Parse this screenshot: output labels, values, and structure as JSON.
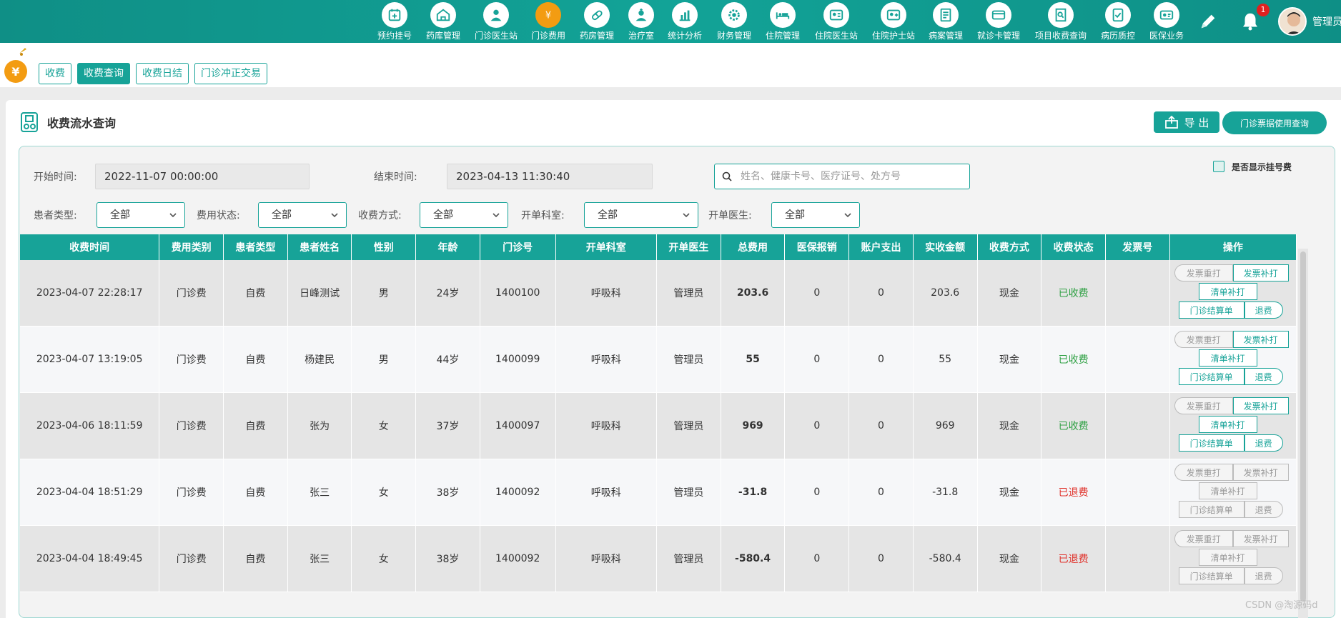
{
  "topnav": [
    {
      "label": "预约挂号",
      "icon": "calendar-plus-icon"
    },
    {
      "label": "药库管理",
      "icon": "warehouse-icon"
    },
    {
      "label": "门诊医生站",
      "icon": "doctor-icon"
    },
    {
      "label": "门诊费用",
      "icon": "yen-coin-icon",
      "active": true
    },
    {
      "label": "药房管理",
      "icon": "pill-icon"
    },
    {
      "label": "治疗室",
      "icon": "nurse-icon"
    },
    {
      "label": "统计分析",
      "icon": "bar-chart-icon"
    },
    {
      "label": "财务管理",
      "icon": "gear-coin-icon"
    },
    {
      "label": "住院管理",
      "icon": "hospital-bed-icon"
    },
    {
      "label": "住院医生站",
      "icon": "doctor-card-icon"
    },
    {
      "label": "住院护士站",
      "icon": "nurse-card-icon"
    },
    {
      "label": "病案管理",
      "icon": "folder-icon"
    },
    {
      "label": "就诊卡管理",
      "icon": "card-icon"
    },
    {
      "label": "项目收费查询",
      "icon": "search-document-icon"
    },
    {
      "label": "病历质控",
      "icon": "record-check-icon"
    },
    {
      "label": "医保业务",
      "icon": "insurance-card-icon"
    }
  ],
  "user": {
    "name": "管理员",
    "notification_count": "1"
  },
  "subnav": {
    "tabs": [
      "收费",
      "收费查询",
      "收费日结",
      "门诊冲正交易"
    ],
    "active_index": 1
  },
  "panel": {
    "title": "收费流水查询",
    "export_label": "导 出",
    "ticket_label": "门诊票据使用查询"
  },
  "filters": {
    "start_label": "开始时间:",
    "start_value": "2022-11-07 00:00:00",
    "end_label": "结束时间:",
    "end_value": "2023-04-13 11:30:40",
    "search_placeholder": "姓名、健康卡号、医疗证号、处方号",
    "show_reg_fee_label": "是否显示挂号费",
    "patient_type_label": "患者类型:",
    "patient_type_value": "全部",
    "fee_status_label": "费用状态:",
    "fee_status_value": "全部",
    "pay_method_label": "收费方式:",
    "pay_method_value": "全部",
    "dept_label": "开单科室:",
    "dept_value": "全部",
    "doctor_label": "开单医生:",
    "doctor_value": "全部"
  },
  "table": {
    "columns": [
      "收费时间",
      "费用类别",
      "患者类型",
      "患者姓名",
      "性别",
      "年龄",
      "门诊号",
      "开单科室",
      "开单医生",
      "总费用",
      "医保报销",
      "账户支出",
      "实收金额",
      "收费方式",
      "收费状态",
      "发票号",
      "操作"
    ],
    "ops": [
      "发票重打",
      "发票补打",
      "清单补打",
      "门诊结算单",
      "退费"
    ],
    "rows": [
      {
        "time": "2023-04-07 22:28:17",
        "cat": "门诊费",
        "ptype": "自费",
        "name": "日峰测试",
        "sex": "男",
        "age": "24岁",
        "no": "1400100",
        "dept": "呼吸科",
        "doctor": "管理员",
        "total": "203.6",
        "insure": "0",
        "account": "0",
        "actual": "203.6",
        "method": "现金",
        "status": "已收费",
        "invoice": ""
      },
      {
        "time": "2023-04-07 13:19:05",
        "cat": "门诊费",
        "ptype": "自费",
        "name": "杨建民",
        "sex": "男",
        "age": "44岁",
        "no": "1400099",
        "dept": "呼吸科",
        "doctor": "管理员",
        "total": "55",
        "insure": "0",
        "account": "0",
        "actual": "55",
        "method": "现金",
        "status": "已收费",
        "invoice": ""
      },
      {
        "time": "2023-04-06 18:11:59",
        "cat": "门诊费",
        "ptype": "自费",
        "name": "张为",
        "sex": "女",
        "age": "37岁",
        "no": "1400097",
        "dept": "呼吸科",
        "doctor": "管理员",
        "total": "969",
        "insure": "0",
        "account": "0",
        "actual": "969",
        "method": "现金",
        "status": "已收费",
        "invoice": ""
      },
      {
        "time": "2023-04-04 18:51:29",
        "cat": "门诊费",
        "ptype": "自费",
        "name": "张三",
        "sex": "女",
        "age": "38岁",
        "no": "1400092",
        "dept": "呼吸科",
        "doctor": "管理员",
        "total": "-31.8",
        "insure": "0",
        "account": "0",
        "actual": "-31.8",
        "method": "现金",
        "status": "已退费",
        "invoice": ""
      },
      {
        "time": "2023-04-04 18:49:45",
        "cat": "门诊费",
        "ptype": "自费",
        "name": "张三",
        "sex": "女",
        "age": "38岁",
        "no": "1400092",
        "dept": "呼吸科",
        "doctor": "管理员",
        "total": "-580.4",
        "insure": "0",
        "account": "0",
        "actual": "-580.4",
        "method": "现金",
        "status": "已退费",
        "invoice": ""
      }
    ]
  },
  "watermark": "CSDN @淘源码d"
}
